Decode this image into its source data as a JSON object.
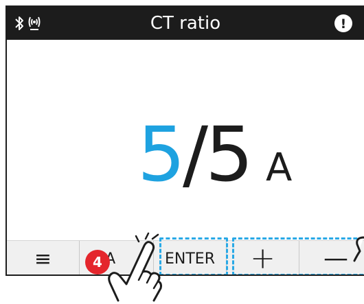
{
  "titlebar": {
    "title": "CT ratio",
    "icons": [
      "bluetooth-icon",
      "wireless-signal-icon",
      "alert-icon"
    ],
    "alert_glyph": "!"
  },
  "value": {
    "primary": "5",
    "secondary": "/5",
    "unit": "A"
  },
  "buttons": {
    "menu_icon": "menu-icon",
    "menu_glyph": "≡",
    "back_label": "BA",
    "enter_label": "ENTER",
    "plus_glyph": "+",
    "minus_glyph": "—"
  },
  "annotation": {
    "step_number": "4"
  },
  "colors": {
    "titlebar_bg": "#1c1c1c",
    "accent": "#1ea2e0",
    "highlight_dash": "#29a9e6",
    "step_badge": "#e4262c"
  }
}
